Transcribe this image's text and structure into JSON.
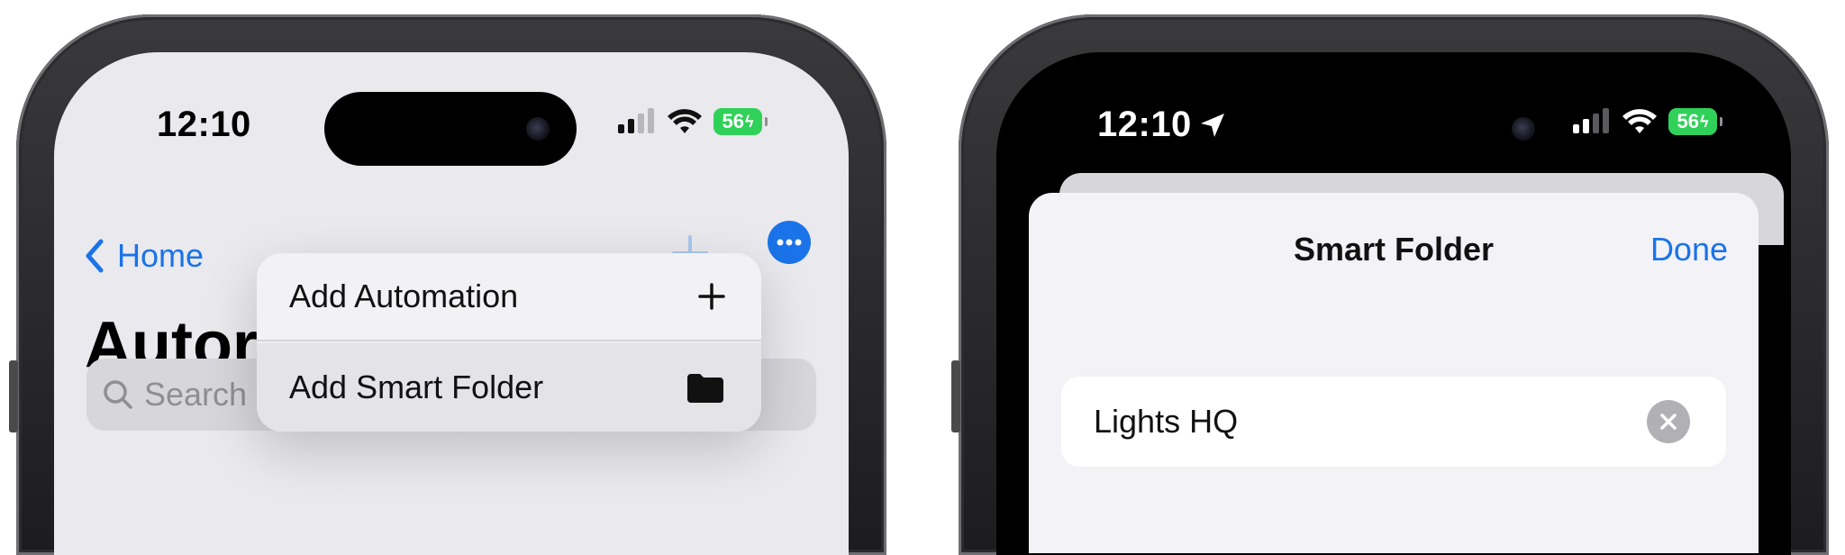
{
  "left_phone": {
    "status": {
      "time": "12:10",
      "battery": "56"
    },
    "nav": {
      "back_label": "Home"
    },
    "title": "Autor",
    "search": {
      "placeholder": "Search"
    },
    "menu": {
      "items": [
        {
          "label": "Add Automation",
          "icon": "plus-icon"
        },
        {
          "label": "Add Smart Folder",
          "icon": "folder-icon"
        }
      ]
    }
  },
  "right_phone": {
    "status": {
      "time": "12:10",
      "battery": "56"
    },
    "sheet": {
      "title": "Smart Folder",
      "done_label": "Done",
      "field_value": "Lights HQ"
    }
  },
  "colors": {
    "accent": "#1a73e8",
    "battery": "#30d158",
    "light_bg": "#e9e9ee",
    "sheet_bg": "#f2f2f7"
  }
}
